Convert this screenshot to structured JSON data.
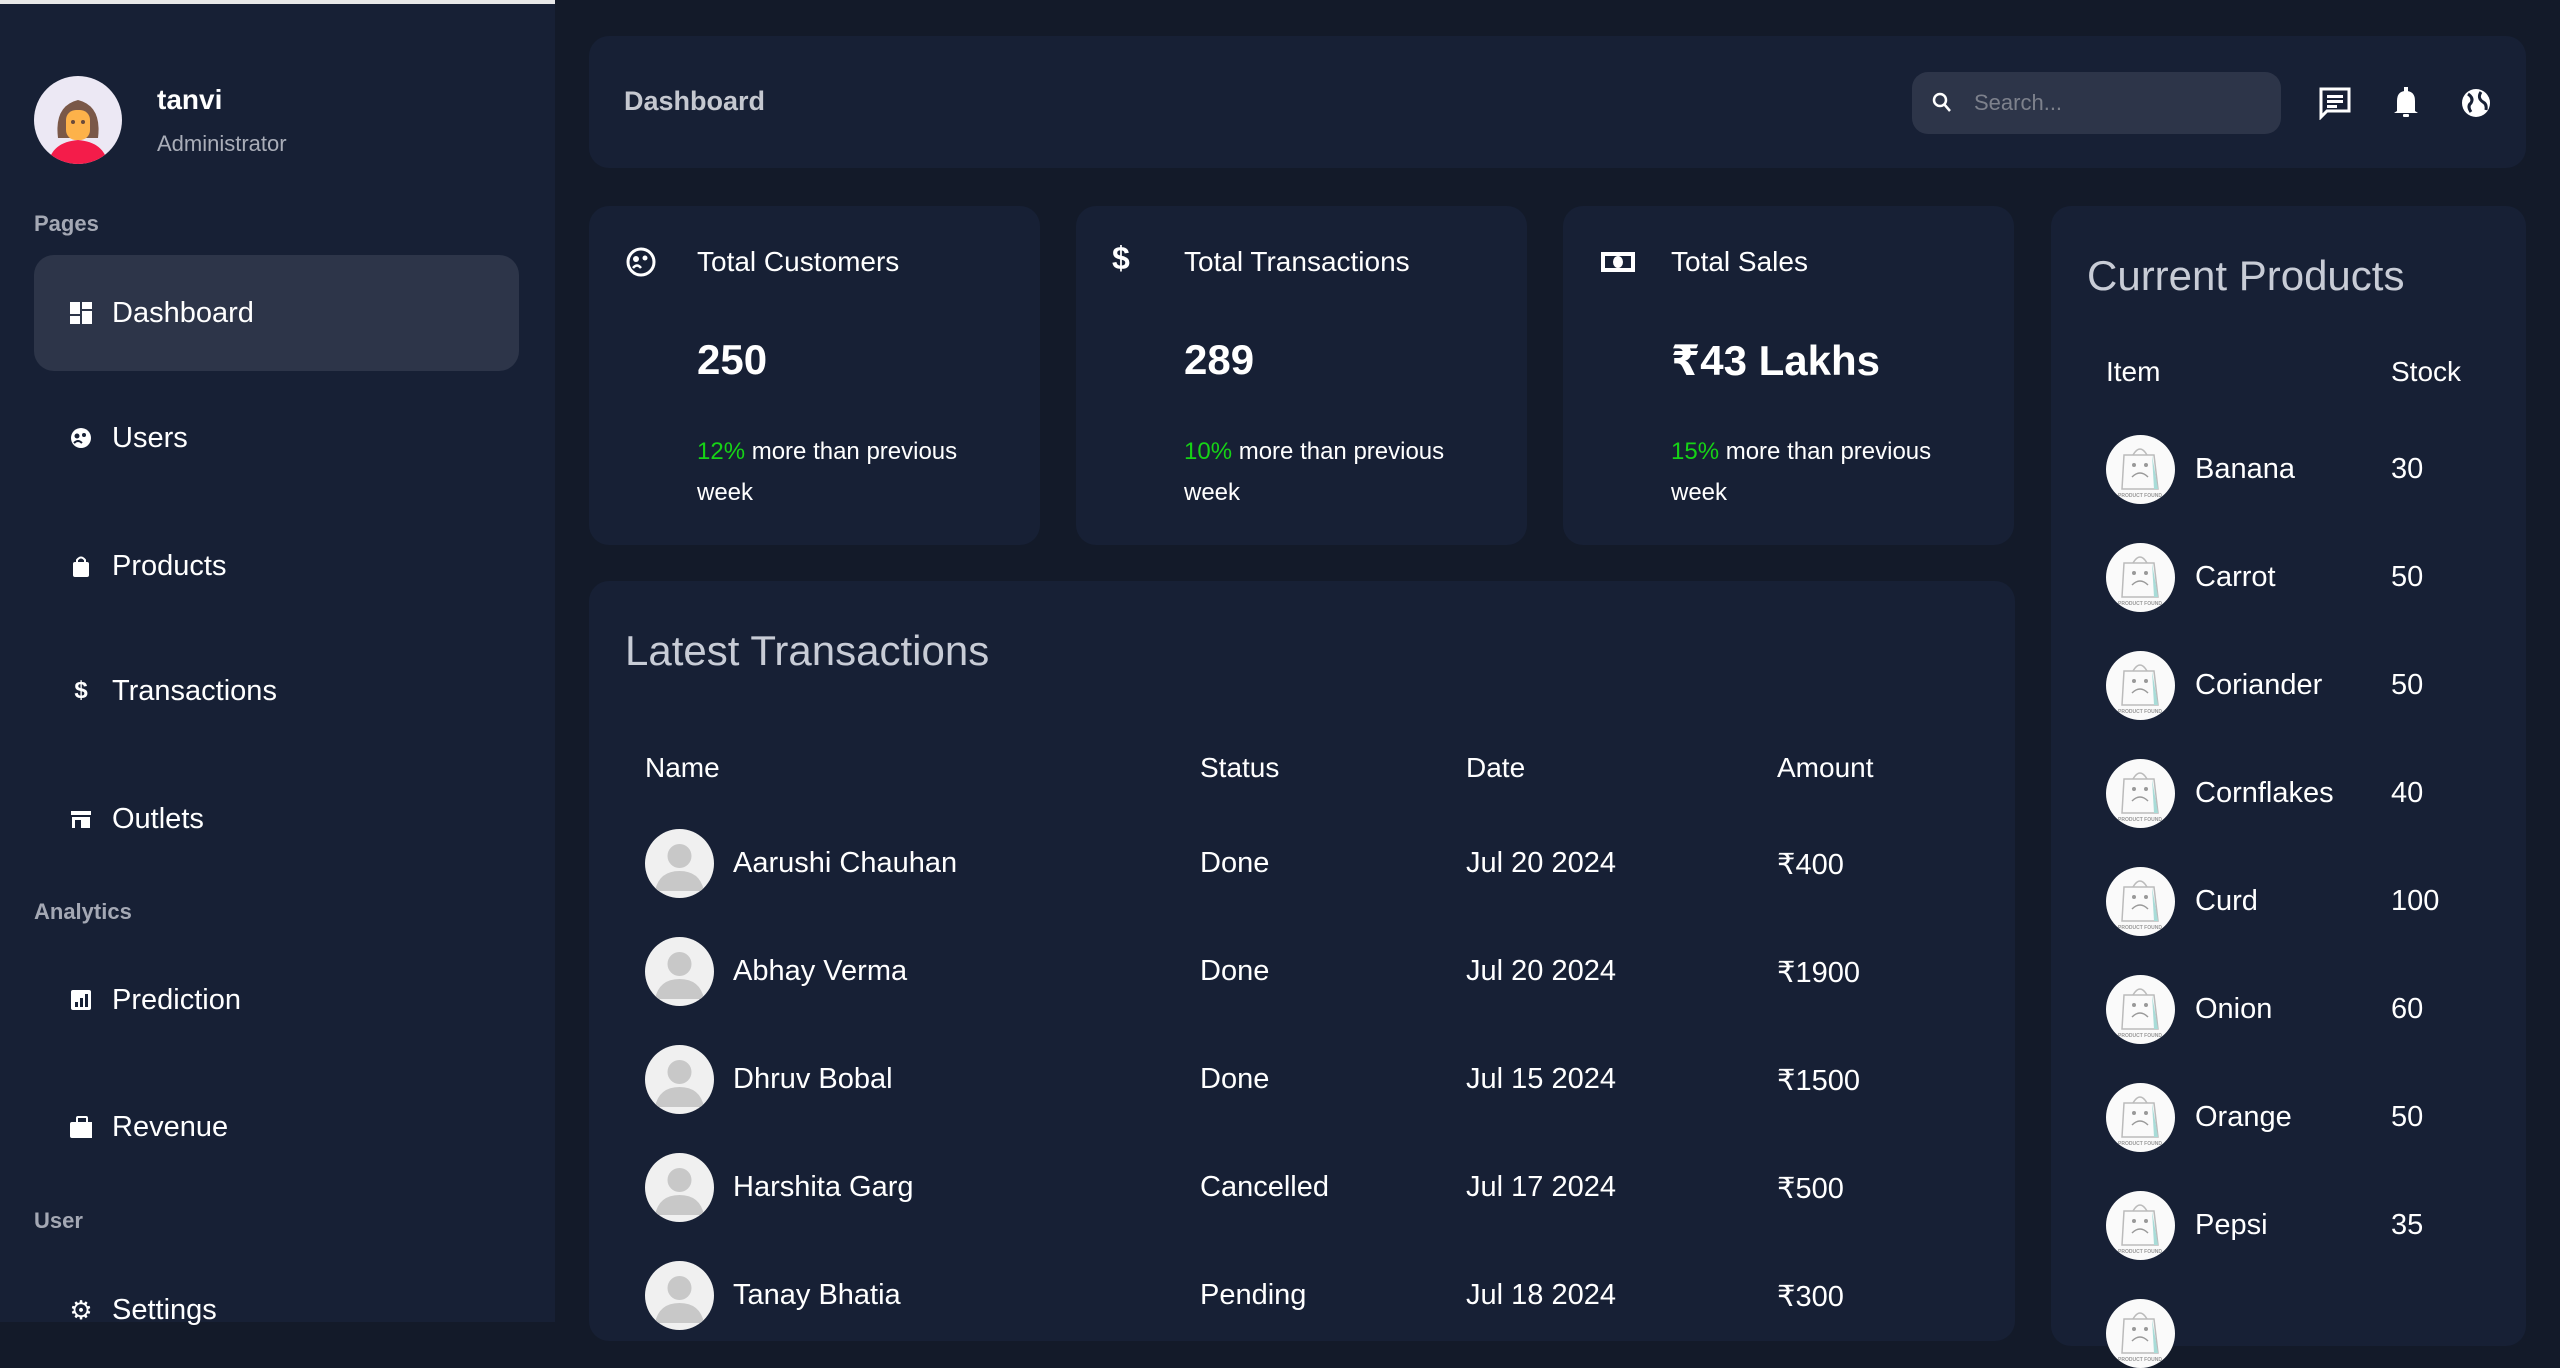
{
  "user": {
    "name": "tanvi",
    "role": "Administrator"
  },
  "sidebar": {
    "sections": [
      "Pages",
      "Analytics",
      "User"
    ],
    "items": [
      {
        "label": "Dashboard",
        "icon": "dashboard-icon",
        "active": true
      },
      {
        "label": "Users",
        "icon": "users-icon"
      },
      {
        "label": "Products",
        "icon": "shopping-bag-icon"
      },
      {
        "label": "Transactions",
        "icon": "dollar-icon"
      },
      {
        "label": "Outlets",
        "icon": "store-icon"
      },
      {
        "label": "Prediction",
        "icon": "chart-icon"
      },
      {
        "label": "Revenue",
        "icon": "briefcase-icon"
      },
      {
        "label": "Settings",
        "icon": "gear-icon"
      }
    ]
  },
  "header": {
    "title": "Dashboard",
    "search_placeholder": "Search...",
    "icons": [
      "chat-icon",
      "bell-icon",
      "globe-icon"
    ]
  },
  "stats": [
    {
      "title": "Total Customers",
      "value": "250",
      "change": "12%",
      "suffix": " more than previous week",
      "icon": "customers-icon"
    },
    {
      "title": "Total Transactions",
      "value": "289",
      "change": "10%",
      "suffix": " more than previous week",
      "icon": "dollar-icon"
    },
    {
      "title": "Total Sales",
      "value": "₹43 Lakhs",
      "change": "15%",
      "suffix": " more than previous week",
      "icon": "money-icon"
    }
  ],
  "colors": {
    "accent_green": "#16d316",
    "background": "#131a29",
    "card": "#172035",
    "active": "#2d3549"
  },
  "transactions": {
    "title": "Latest Transactions",
    "columns": [
      "Name",
      "Status",
      "Date",
      "Amount"
    ],
    "rows": [
      {
        "name": "Aarushi Chauhan",
        "status": "Done",
        "date": "Jul 20 2024",
        "amount": "₹400"
      },
      {
        "name": "Abhay Verma",
        "status": "Done",
        "date": "Jul 20 2024",
        "amount": "₹1900"
      },
      {
        "name": "Dhruv Bobal",
        "status": "Done",
        "date": "Jul 15 2024",
        "amount": "₹1500"
      },
      {
        "name": "Harshita Garg",
        "status": "Cancelled",
        "date": "Jul 17 2024",
        "amount": "₹500"
      },
      {
        "name": "Tanay Bhatia",
        "status": "Pending",
        "date": "Jul 18 2024",
        "amount": "₹300"
      }
    ]
  },
  "products": {
    "title": "Current Products",
    "columns": [
      "Item",
      "Stock"
    ],
    "rows": [
      {
        "item": "Banana",
        "stock": "30"
      },
      {
        "item": "Carrot",
        "stock": "50"
      },
      {
        "item": "Coriander",
        "stock": "50"
      },
      {
        "item": "Cornflakes",
        "stock": "40"
      },
      {
        "item": "Curd",
        "stock": "100"
      },
      {
        "item": "Onion",
        "stock": "60"
      },
      {
        "item": "Orange",
        "stock": "50"
      },
      {
        "item": "Pepsi",
        "stock": "35"
      }
    ]
  }
}
